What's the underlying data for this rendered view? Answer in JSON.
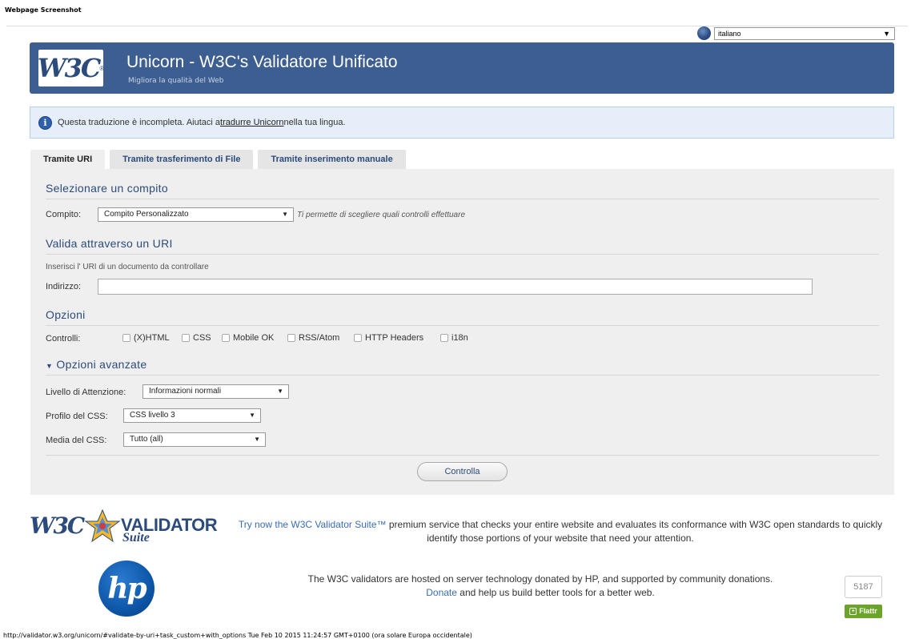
{
  "screenshot_caption": "Webpage Screenshot",
  "language_selector": {
    "value": "italiano",
    "icon": "globe-icon"
  },
  "banner": {
    "logo_text": "W3C",
    "logo_mark": "®",
    "title": "Unicorn - W3C's Validatore Unificato",
    "subtitle": "Migliora la qualità del Web"
  },
  "notice": {
    "icon": "info-icon",
    "text_before": "Questa traduzione è incompleta. Aiutaci a ",
    "link": "tradurre Unicorn",
    "text_after": " nella tua lingua."
  },
  "tabs": [
    {
      "label": "Tramite URI",
      "active": true
    },
    {
      "label": "Tramite trasferimento di File",
      "active": false
    },
    {
      "label": "Tramite inserimento manuale",
      "active": false
    }
  ],
  "task": {
    "heading": "Selezionare un compito",
    "label": "Compito:",
    "value": "Compito Personalizzato",
    "hint": "Ti permette di scegliere quali controlli effettuare"
  },
  "uri": {
    "heading": "Valida attraverso un URI",
    "instruction": "Inserisci l' URI di un documento da controllare",
    "label": "Indirizzo:",
    "value": ""
  },
  "options": {
    "heading": "Opzioni",
    "label": "Controlli:",
    "checks": [
      "(X)HTML",
      "CSS",
      "Mobile OK",
      "RSS/Atom",
      "HTTP Headers",
      "i18n"
    ]
  },
  "advanced": {
    "heading": "Opzioni avanzate",
    "warning_label": "Livello di Attenzione:",
    "warning_value": "Informazioni normali",
    "css_profile_label": "Profilo del CSS:",
    "css_profile_value": "CSS livello 3",
    "css_media_label": "Media del CSS:",
    "css_media_value": "Tutto (all)"
  },
  "submit_label": "Controlla",
  "validator_suite": {
    "logo_w3c": "W3C",
    "logo_title": "VALIDATOR",
    "logo_sub": "Suite",
    "promo_link": "Try now the W3C Validator Suite™",
    "promo_text": " premium service that checks your entire website and evaluates its conformance with W3C open standards to quickly identify those portions of your website that need your attention."
  },
  "hp": {
    "logo_text": "hp",
    "hosted_text": "The W3C validators are hosted on server technology donated by HP, and supported by community donations.",
    "donate_link": "Donate",
    "donate_text": " and help us build better tools for a better web."
  },
  "flattr": {
    "count": "5187",
    "label": "Flattr"
  },
  "status_bar": "http://validator.w3.org/unicorn/#validate-by-uri+task_custom+with_options Tue Feb 10 2015 11:24:57 GMT+0100 (ora solare Europa occidentale)"
}
